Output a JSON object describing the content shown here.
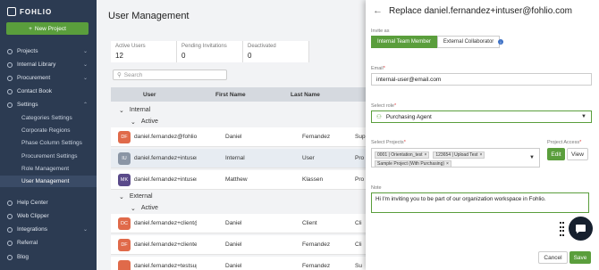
{
  "brand": {
    "name": "FOHLIO"
  },
  "sidebar": {
    "new_project_label": "New Project",
    "items": [
      {
        "label": "Projects",
        "has_chevron": true
      },
      {
        "label": "Internal Library",
        "has_chevron": true
      },
      {
        "label": "Procurement",
        "has_chevron": true
      },
      {
        "label": "Contact Book",
        "has_chevron": false
      },
      {
        "label": "Settings",
        "has_chevron": true
      }
    ],
    "settings_sub": [
      "Categories Settings",
      "Corporate Regions",
      "Phase Column Settings",
      "Procurement Settings",
      "Role Management",
      "User Management"
    ],
    "active_sub": "User Management",
    "bottom_items": [
      "Help Center",
      "Web Clipper",
      "Integrations",
      "Referral",
      "Blog"
    ]
  },
  "main": {
    "title": "User Management",
    "stats": [
      {
        "label": "Active Users",
        "value": "12"
      },
      {
        "label": "Pending Invitations",
        "value": "0"
      },
      {
        "label": "Deactivated",
        "value": "0"
      }
    ],
    "search_placeholder": "Search",
    "columns": {
      "user": "User",
      "first_name": "First Name",
      "last_name": "Last Name"
    },
    "groups": {
      "internal": "Internal",
      "internal_active": "Active",
      "external": "External",
      "external_active": "Active"
    },
    "internal_rows": [
      {
        "initials": "DF",
        "color": "#e06a4a",
        "email": "daniel.fernandez@fohlio.c",
        "first": "Daniel",
        "last": "Fernandez",
        "role": "Sup"
      },
      {
        "initials": "IU",
        "color": "#8a95a5",
        "email": "daniel.fernandez+intuser@",
        "first": "Internal",
        "last": "User",
        "role": "Pro"
      },
      {
        "initials": "MK",
        "color": "#5a4a8a",
        "email": "daniel.fernandez+intuser2",
        "first": "Matthew",
        "last": "Klassen",
        "role": "Pro"
      }
    ],
    "external_rows": [
      {
        "initials": "DC",
        "color": "#e06a4a",
        "email": "daniel.fernandez+client@",
        "first": "Daniel",
        "last": "Client",
        "role": "Cli"
      },
      {
        "initials": "DF",
        "color": "#e06a4a",
        "email": "daniel.fernandez+clientes",
        "first": "Daniel",
        "last": "Fernandez",
        "role": "Cli"
      },
      {
        "initials": "",
        "color": "#e06a4a",
        "email": "daniel.fernandez+testsup",
        "first": "Daniel",
        "last": "Fernandez",
        "role": "Su"
      }
    ]
  },
  "modal": {
    "title": "Replace daniel.fernandez+intuser@fohlio.com",
    "invite_as_label": "Invite as",
    "invite_options": [
      "Internal Team Member",
      "External Collaborator"
    ],
    "invite_selected": "Internal Team Member",
    "email_label": "Email",
    "email_value": "internal-user@email.com",
    "role_label": "Select role",
    "role_value": "Purchasing Agent",
    "projects_label": "Select Projects",
    "projects": [
      "0001 | Orientation_test",
      "123654 | Upload Test",
      "Sample Project (With Purchasing)"
    ],
    "project_access_label": "Project Access",
    "edit_label": "Edit",
    "view_label": "View",
    "note_label": "Note",
    "note_value": "Hi I'm inviting you to be part of our organization workspace in Fohlio.",
    "cancel_label": "Cancel",
    "save_label": "Save"
  },
  "colors": {
    "accent": "#5a9e3c",
    "sidebar_bg": "#2c3b52",
    "required": "#e03c3c"
  },
  "icons": [
    "back-arrow-icon",
    "info-icon",
    "search-icon",
    "chat-icon",
    "chevron-down-icon",
    "drag-handle-icon"
  ]
}
